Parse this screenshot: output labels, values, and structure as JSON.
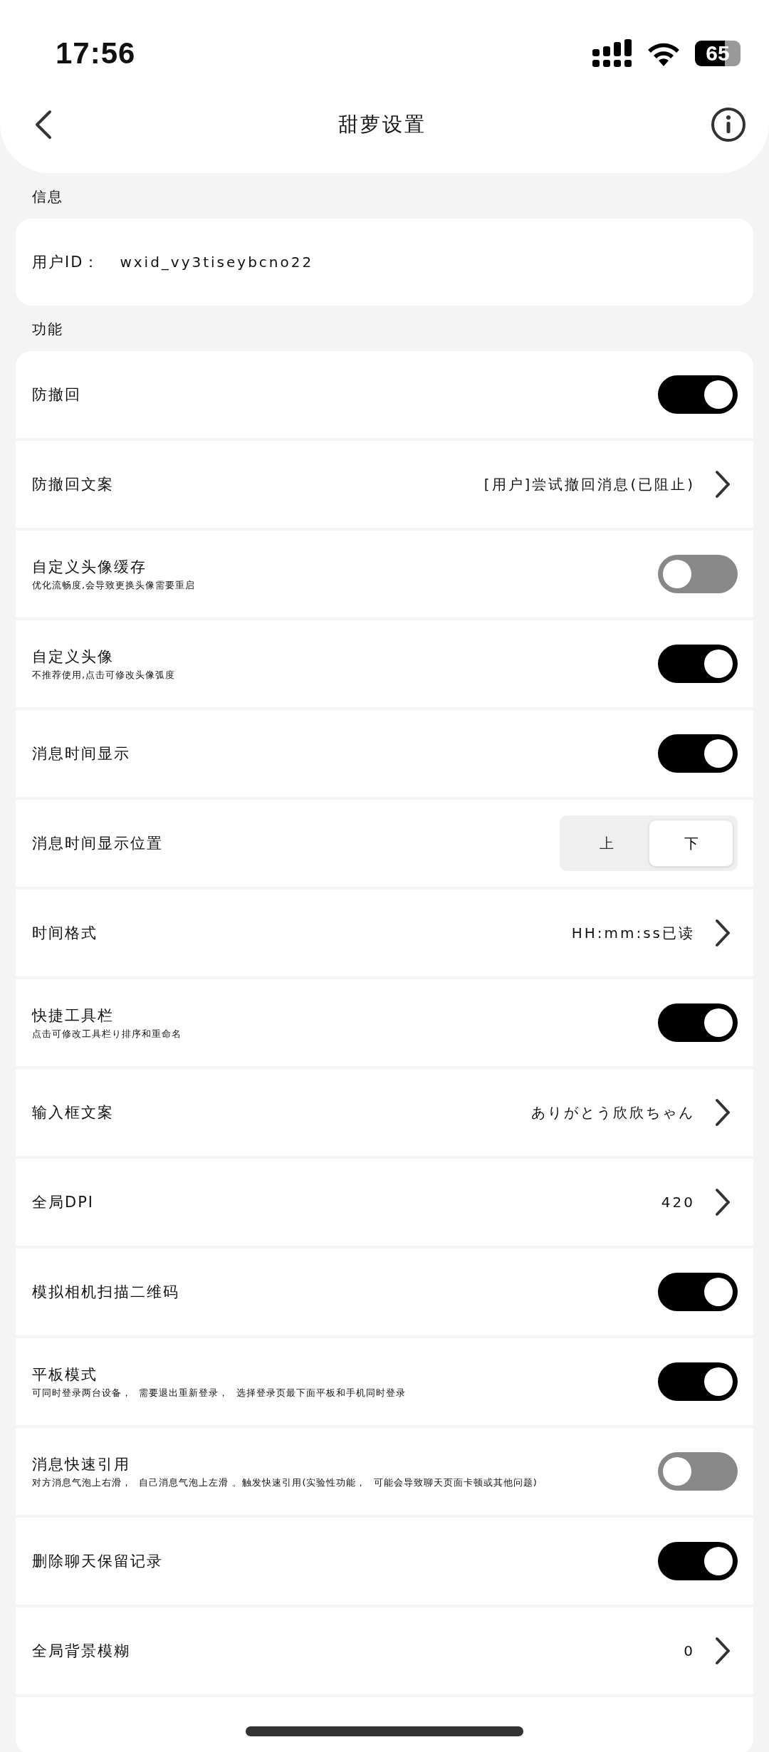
{
  "status_bar": {
    "time": "17:56",
    "battery": "65"
  },
  "header": {
    "title": "甜萝设置"
  },
  "sections": [
    {
      "title": "信息",
      "rows": [
        {
          "kind": "text",
          "label": "用户ID：",
          "value": "wxid_vy3tiseybcno22"
        }
      ]
    },
    {
      "title": "功能",
      "rows": [
        {
          "kind": "toggle",
          "label": "防撤回",
          "on": true
        },
        {
          "kind": "link",
          "label": "防撤回文案",
          "value": "[用户]尝试撤回消息(已阻止)"
        },
        {
          "kind": "toggle",
          "label": "自定义头像缓存",
          "subtitle": "优化流畅度,会导致更换头像需要重启",
          "on": false
        },
        {
          "kind": "toggle",
          "label": "自定义头像",
          "subtitle": "不推荐使用,点击可修改头像弧度",
          "on": true
        },
        {
          "kind": "toggle",
          "label": "消息时间显示",
          "on": true
        },
        {
          "kind": "segment",
          "label": "消息时间显示位置",
          "options": [
            {
              "label": "上",
              "selected": false
            },
            {
              "label": "下",
              "selected": true
            }
          ]
        },
        {
          "kind": "link",
          "label": "时间格式",
          "value": "HH:mm:ss已读"
        },
        {
          "kind": "toggle",
          "label": "快捷工具栏",
          "subtitle": "点击可修改工具栏り排序和重命名",
          "on": true
        },
        {
          "kind": "link",
          "label": "输入框文案",
          "value": "ありがとう欣欣ちゃん"
        },
        {
          "kind": "link",
          "label": "全局DPI",
          "value": "420"
        },
        {
          "kind": "toggle",
          "label": "模拟相机扫描二维码",
          "on": true
        },
        {
          "kind": "toggle",
          "label": "平板模式",
          "subtitle": "可同时登录两台设备，  需要退出重新登录，  选择登录页最下面平板和手机同时登录",
          "on": true
        },
        {
          "kind": "toggle",
          "label": "消息快速引用",
          "subtitle": "对方消息气泡上右滑，  自己消息气泡上左滑 。触发快速引用(实验性功能，  可能会导致聊天页面卡顿或其他问题)",
          "on": false
        },
        {
          "kind": "toggle",
          "label": "删除聊天保留记录",
          "on": true
        },
        {
          "kind": "link",
          "label": "全局背景模糊",
          "value": "0"
        }
      ]
    }
  ]
}
